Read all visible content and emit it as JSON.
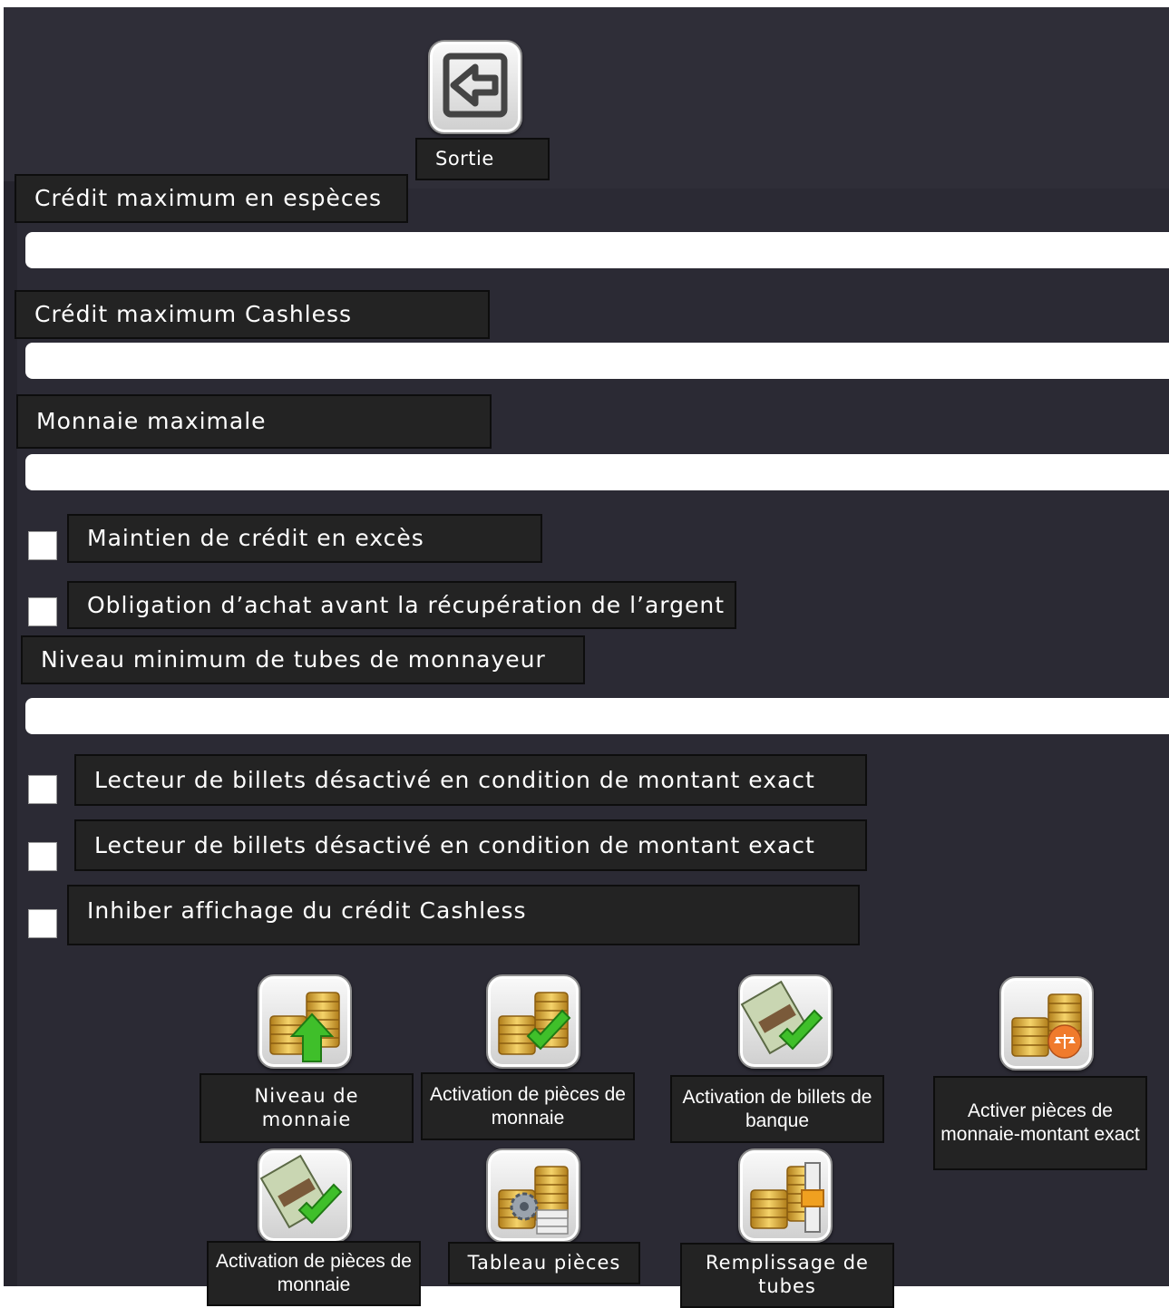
{
  "header": {
    "exit_label": "Sortie"
  },
  "form": {
    "max_cash_credit": {
      "label": "Crédit maximum en espèces",
      "value": ""
    },
    "max_cashless_credit": {
      "label": "Crédit maximum Cashless",
      "value": ""
    },
    "max_change": {
      "label": "Monnaie maximale",
      "value": ""
    },
    "keep_excess_credit": {
      "label": "Maintien de crédit en excès",
      "checked": false
    },
    "purchase_before_refund": {
      "label": "Obligation d’achat avant la récupération de l’argent",
      "checked": false
    },
    "min_tube_level": {
      "label": "Niveau minimum de tubes de monnayeur",
      "value": ""
    },
    "bill_reader_disabled_1": {
      "label": "Lecteur de billets désactivé en condition de montant exact",
      "checked": false
    },
    "bill_reader_disabled_2": {
      "label": "Lecteur de billets désactivé en condition de montant exact",
      "checked": false
    },
    "inhibit_cashless_display": {
      "label": "Inhiber affichage du crédit Cashless",
      "checked": false
    }
  },
  "actions": {
    "change_level": "Niveau de monnaie",
    "coin_activation": "Activation de pièces de monnaie",
    "bill_activation": "Activation de billets de banque",
    "exact_change_coins": "Activer pièces de monnaie-montant exact",
    "coin_activation_2": "Activation de pièces de monnaie",
    "coin_table": "Tableau pièces",
    "tube_filling": "Remplissage de tubes"
  },
  "colors": {
    "background": "#2b2a34",
    "label_box": "#232323",
    "gold": "#e2b33c",
    "green_check": "#3fbf2a",
    "orange_badge": "#f07b2c"
  },
  "icons": {
    "exit": "exit-arrow-icon",
    "change_level": "coins-up-arrow-icon",
    "coin_activation": "coins-check-icon",
    "bill_activation": "banknote-check-icon",
    "exact_change_coins": "coins-balance-icon",
    "coin_activation_2": "banknote-check-icon",
    "coin_table": "coins-gear-icon",
    "tube_filling": "coins-level-icon"
  }
}
